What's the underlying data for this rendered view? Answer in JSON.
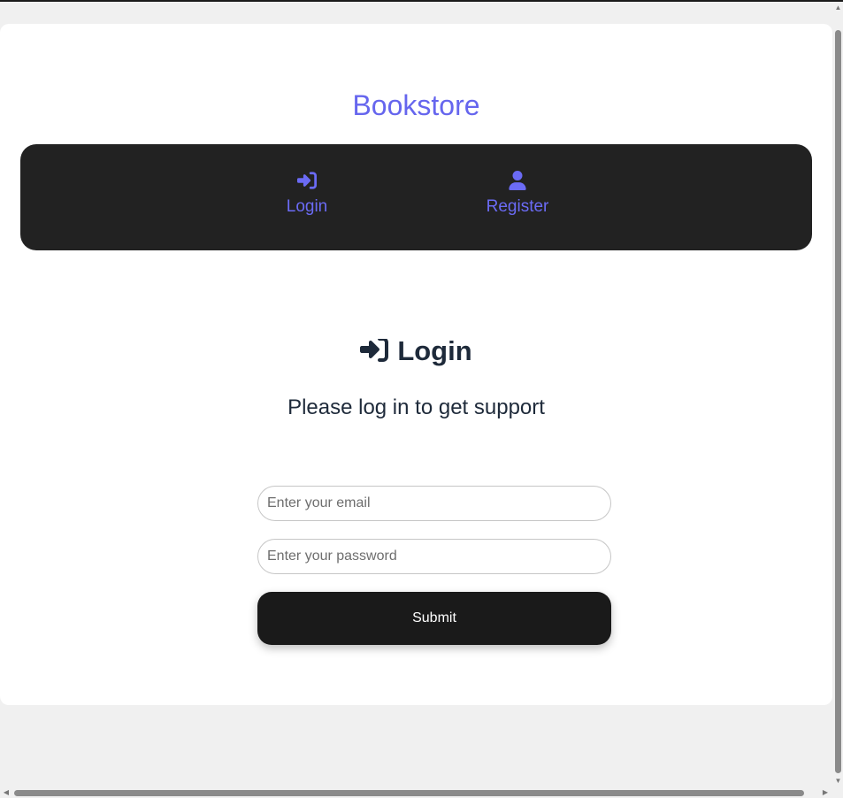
{
  "header": {
    "brand": "Bookstore"
  },
  "nav": {
    "items": [
      {
        "label": "Login",
        "icon": "sign-in-icon"
      },
      {
        "label": "Register",
        "icon": "user-icon"
      }
    ],
    "accent_color": "#6b6bf5",
    "background": "#222222"
  },
  "main": {
    "heading": "Login",
    "subtitle": "Please log in to get support"
  },
  "form": {
    "email_placeholder": "Enter your email",
    "password_placeholder": "Enter your password",
    "email_value": "",
    "password_value": "",
    "submit_label": "Submit"
  }
}
